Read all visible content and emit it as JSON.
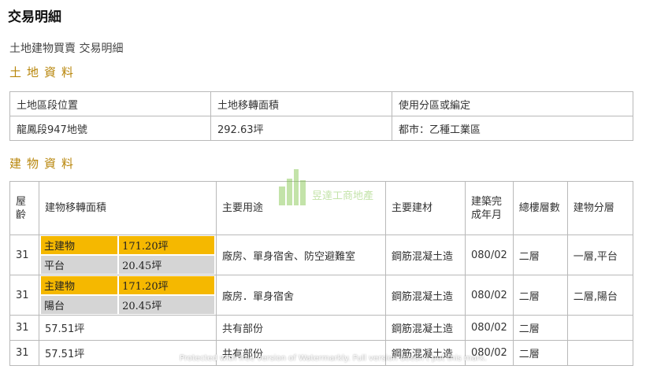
{
  "page": {
    "title": "交易明細",
    "subtitle": "土地建物買賣 交易明細"
  },
  "land": {
    "heading": "土地資料",
    "headers": [
      "土地區段位置",
      "土地移轉面積",
      "使用分區或編定"
    ],
    "row": [
      "龍鳳段947地號",
      "292.63坪",
      "都市：乙種工業區"
    ]
  },
  "building": {
    "heading": "建物資料",
    "headers": {
      "age": "屋齡",
      "area": "建物移轉面積",
      "use": "主要用途",
      "material": "主要建材",
      "completed": "建築完成年月",
      "floors": "總樓層數",
      "floor_split": "建物分層"
    },
    "rows": [
      {
        "age": "31",
        "area_main_label": "主建物",
        "area_main_value": "171.20坪",
        "area_sub_label": "平台",
        "area_sub_value": "20.45坪",
        "use": "廠房、單身宿舍、防空避難室",
        "material": "鋼筋混凝土造",
        "completed": "080/02",
        "floors": "二層",
        "floor_split": "一層,平台"
      },
      {
        "age": "31",
        "area_main_label": "主建物",
        "area_main_value": "171.20坪",
        "area_sub_label": "陽台",
        "area_sub_value": "20.45坪",
        "use": "廠房．單身宿舍",
        "material": "鋼筋混凝土造",
        "completed": "080/02",
        "floors": "二層",
        "floor_split": "二層,陽台"
      },
      {
        "age": "31",
        "area": "57.51坪",
        "use": "共有部份",
        "material": "鋼筋混凝土造",
        "completed": "080/02",
        "floors": "二層",
        "floor_split": ""
      },
      {
        "age": "31",
        "area": "57.51坪",
        "use": "共有部份",
        "material": "鋼筋混凝土造",
        "completed": "080/02",
        "floors": "二層",
        "floor_split": ""
      }
    ]
  },
  "watermark": {
    "logo_text": "昱達工商地產",
    "footer_text": "Protected with free version of Watermarkly. Full version doesn't put this mark."
  },
  "colors": {
    "heading_gold": "#b8860b",
    "main_building_yellow": "#f5b800",
    "sub_area_gray": "#d5d5d5",
    "border": "#b9b9b9",
    "watermark_green": "#7cc242"
  }
}
